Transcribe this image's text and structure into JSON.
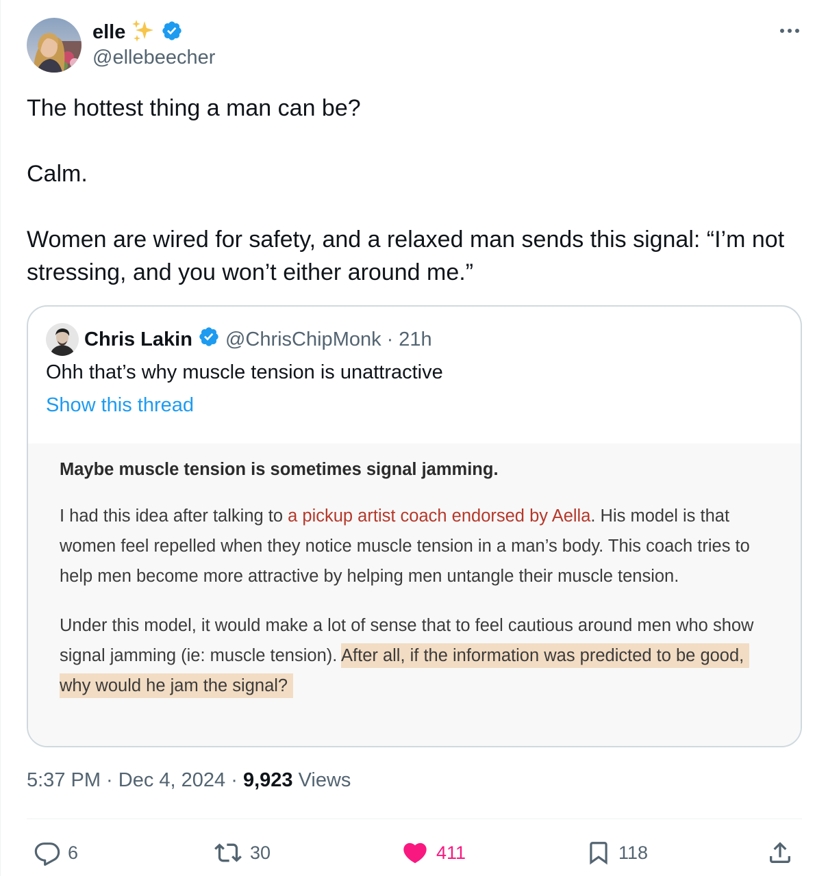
{
  "tweet": {
    "author": {
      "name": "elle",
      "emoji": "✨",
      "handle": "@ellebeecher",
      "verified": true
    },
    "text": [
      "The hottest thing a man can be?",
      "Calm.",
      "Women are wired for safety, and a relaxed man sends this signal: “I’m not stressing, and you won’t either around me.”"
    ],
    "quoted": {
      "name": "Chris Lakin",
      "handle": "@ChrisChipMonk",
      "separator": "·",
      "time": "21h",
      "verified": true,
      "text": "Ohh that’s why muscle tension is unattractive",
      "show_thread": "Show this thread",
      "image": {
        "heading": "Maybe muscle tension is sometimes signal jamming.",
        "p1_before": "I had this idea after talking to ",
        "p1_link": "a pickup artist coach endorsed by Aella",
        "p1_after": ". His model is that women feel repelled when they notice muscle tension in a man’s body. This coach tries to help men become more attractive by helping men untangle their muscle tension.",
        "p2_before": "Under this model, it would make a lot of sense that to feel cautious around men who show signal jamming (ie: muscle tension). ",
        "p2_highlight": "After all, if the information was predicted to be good, why would he jam the signal?",
        "link_color": "#b5382a",
        "highlight_color": "#f2dcc3"
      }
    },
    "meta": {
      "time": "5:37 PM",
      "dot1": " · ",
      "date": "Dec 4, 2024",
      "dot2": " · ",
      "views_count": "9,923",
      "views_label": " Views"
    },
    "actions": {
      "replies": "6",
      "retweets": "30",
      "likes": "411",
      "bookmarks": "118"
    },
    "colors": {
      "verified": "#1d9bf0",
      "like": "#f91880",
      "link": "#1d9bf0",
      "secondary": "#536471"
    }
  }
}
